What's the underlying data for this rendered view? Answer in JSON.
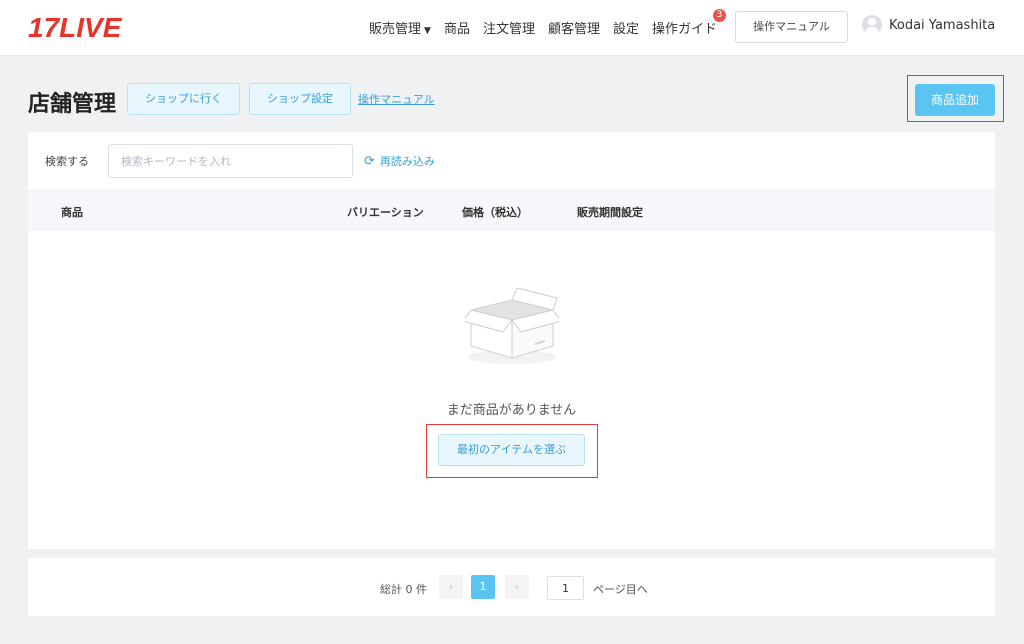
{
  "brand": {
    "logo": "17LIVE"
  },
  "nav": {
    "items": [
      {
        "label": "販売管理",
        "has_caret": true
      },
      {
        "label": "商品"
      },
      {
        "label": "注文管理"
      },
      {
        "label": "顧客管理"
      },
      {
        "label": "設定"
      },
      {
        "label": "操作ガイド",
        "badge": "3"
      }
    ],
    "caret_glyph": "▼",
    "manual_button": "操作マニュアル",
    "user_name": "Kodai Yamashita"
  },
  "page": {
    "title": "店舗管理",
    "go_shop_button": "ショップに行く",
    "shop_settings_button": "ショップ設定",
    "manual_link": "操作マニュアル",
    "add_product_button": "商品追加"
  },
  "search": {
    "label": "検索する",
    "placeholder": "検索キーワードを入れ",
    "value": "",
    "reload_label": "再読み込み"
  },
  "table": {
    "columns": [
      "商品",
      "バリエーション",
      "価格（税込）",
      "販売期間設定"
    ],
    "empty_text": "まだ商品がありません",
    "choose_first_button": "最初のアイテムを選ぶ"
  },
  "pagination": {
    "total_text": "総計 0 件",
    "prev": "‹",
    "next": "›",
    "current_page": "1",
    "goto_value": "1",
    "goto_label": "ページ目へ"
  },
  "colors": {
    "brand_red": "#e8332a",
    "accent_blue": "#5bc5f2",
    "link_blue": "#3a9fd4",
    "highlight_red": "#e53935"
  }
}
